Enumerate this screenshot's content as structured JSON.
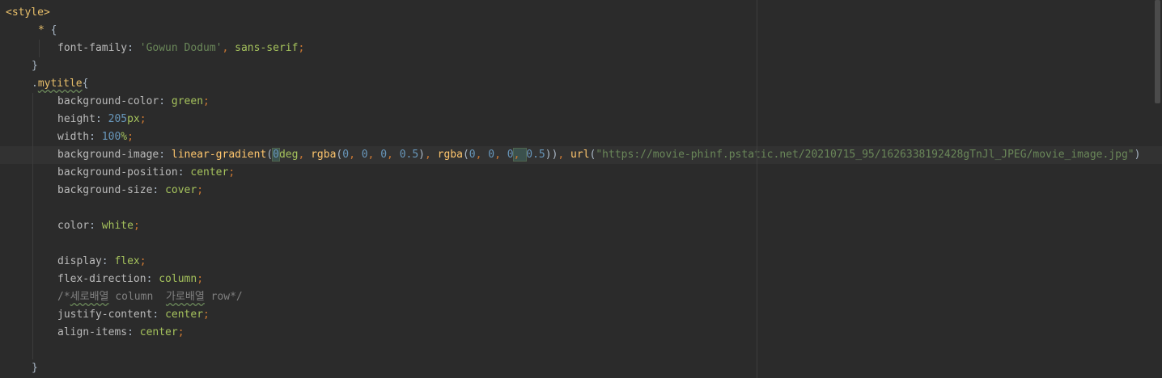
{
  "editor": {
    "language": "css-in-html",
    "lines": [
      {
        "tokens": [
          [
            "tag",
            "<style>"
          ]
        ]
      },
      {
        "tokens": [
          [
            "sel",
            "* "
          ],
          [
            "plain",
            "{"
          ]
        ]
      },
      {
        "tokens": [
          [
            "prop",
            "font-family"
          ],
          [
            "plain",
            ": "
          ],
          [
            "str",
            "'Gowun Dodum'"
          ],
          [
            "punct",
            ", "
          ],
          [
            "kw",
            "sans-serif"
          ],
          [
            "punct",
            ";"
          ]
        ]
      },
      {
        "tokens": [
          [
            "plain",
            "}"
          ]
        ]
      },
      {
        "tokens": [
          [
            "plain",
            "."
          ],
          [
            "sel",
            "mytitle"
          ],
          [
            "plain",
            "{"
          ]
        ]
      },
      {
        "tokens": [
          [
            "prop",
            "background-color"
          ],
          [
            "plain",
            ": "
          ],
          [
            "kw",
            "green"
          ],
          [
            "punct",
            ";"
          ]
        ]
      },
      {
        "tokens": [
          [
            "prop",
            "height"
          ],
          [
            "plain",
            ": "
          ],
          [
            "num",
            "205"
          ],
          [
            "kw",
            "px"
          ],
          [
            "punct",
            ";"
          ]
        ]
      },
      {
        "tokens": [
          [
            "prop",
            "width"
          ],
          [
            "plain",
            ": "
          ],
          [
            "num",
            "100"
          ],
          [
            "kw",
            "%"
          ],
          [
            "punct",
            ";"
          ]
        ]
      },
      {
        "tokens": [
          [
            "prop",
            "background-image"
          ],
          [
            "plain",
            ": "
          ],
          [
            "fn",
            "linear-gradient"
          ],
          [
            "plain",
            "("
          ],
          [
            "num",
            "0"
          ],
          [
            "kw",
            "deg"
          ],
          [
            "punct",
            ", "
          ],
          [
            "fn",
            "rgba"
          ],
          [
            "plain",
            "("
          ],
          [
            "num",
            "0"
          ],
          [
            "punct",
            ", "
          ],
          [
            "num",
            "0"
          ],
          [
            "punct",
            ", "
          ],
          [
            "num",
            "0"
          ],
          [
            "punct",
            ", "
          ],
          [
            "num",
            "0.5"
          ],
          [
            "plain",
            ")"
          ],
          [
            "punct",
            ", "
          ],
          [
            "fn",
            "rgba"
          ],
          [
            "plain",
            "("
          ],
          [
            "num",
            "0"
          ],
          [
            "punct",
            ", "
          ],
          [
            "num",
            "0"
          ],
          [
            "punct",
            ", "
          ],
          [
            "num",
            "0"
          ],
          [
            "punct",
            ", "
          ],
          [
            "num",
            "0.5"
          ],
          [
            "plain",
            ")"
          ],
          [
            "plain",
            ")"
          ],
          [
            "punct",
            ", "
          ],
          [
            "fn",
            "url"
          ],
          [
            "plain",
            "("
          ],
          [
            "str",
            "\"https://movie-phinf.pstatic.net/20210715_95/1626338192428gTnJl_JPEG/movie_image.jpg\""
          ],
          [
            "plain",
            ")"
          ]
        ]
      },
      {
        "tokens": [
          [
            "prop",
            "background-position"
          ],
          [
            "plain",
            ": "
          ],
          [
            "kw",
            "center"
          ],
          [
            "punct",
            ";"
          ]
        ]
      },
      {
        "tokens": [
          [
            "prop",
            "background-size"
          ],
          [
            "plain",
            ": "
          ],
          [
            "kw",
            "cover"
          ],
          [
            "punct",
            ";"
          ]
        ]
      },
      {
        "tokens": []
      },
      {
        "tokens": [
          [
            "prop",
            "color"
          ],
          [
            "plain",
            ": "
          ],
          [
            "kw",
            "white"
          ],
          [
            "punct",
            ";"
          ]
        ]
      },
      {
        "tokens": []
      },
      {
        "tokens": [
          [
            "prop",
            "display"
          ],
          [
            "plain",
            ": "
          ],
          [
            "kw",
            "flex"
          ],
          [
            "punct",
            ";"
          ]
        ]
      },
      {
        "tokens": [
          [
            "prop",
            "flex-direction"
          ],
          [
            "plain",
            ": "
          ],
          [
            "kw",
            "column"
          ],
          [
            "punct",
            ";"
          ]
        ]
      },
      {
        "tokens": [
          [
            "cmt",
            "/*세로배열 column  가로배열 row*/"
          ]
        ]
      },
      {
        "tokens": [
          [
            "prop",
            "justify-content"
          ],
          [
            "plain",
            ": "
          ],
          [
            "kw",
            "center"
          ],
          [
            "punct",
            ";"
          ]
        ]
      },
      {
        "tokens": [
          [
            "prop",
            "align-items"
          ],
          [
            "plain",
            ": "
          ],
          [
            "kw",
            "center"
          ],
          [
            "punct",
            ";"
          ]
        ]
      },
      {
        "tokens": []
      },
      {
        "tokens": [
          [
            "plain",
            "}"
          ]
        ]
      }
    ]
  },
  "colors": {
    "background": "#2b2b2b",
    "current_line": "#323232",
    "tag": "#e8bf6a",
    "property": "#bababa",
    "string": "#6a8759",
    "keyword_value": "#a5c25c",
    "number": "#6897bb",
    "punctuation": "#cc7832",
    "function": "#ffc66d",
    "comment": "#808080",
    "default_text": "#a9b7c6"
  }
}
